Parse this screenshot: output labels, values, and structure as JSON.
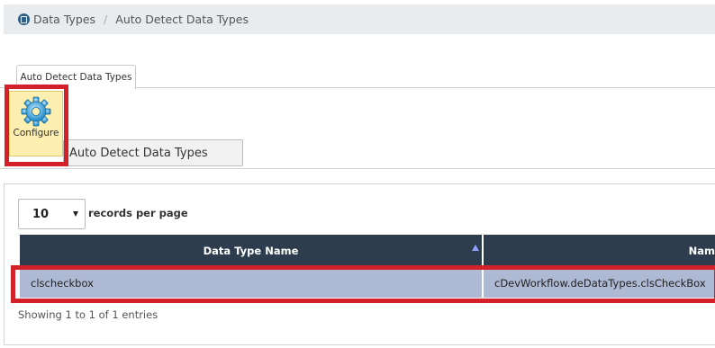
{
  "breadcrumb": {
    "icon": "data-types-icon",
    "root": "Data Types",
    "separator": "/",
    "current": "Auto Detect Data Types"
  },
  "tabs": [
    {
      "label": "Auto Detect Data Types",
      "active": true
    }
  ],
  "ribbon": {
    "configure_label": "Configure",
    "configure_icon": "gear-icon",
    "section_label": "Auto Detect Data Types"
  },
  "table_controls": {
    "page_size": "10",
    "records_per_page_label": "records per page"
  },
  "table": {
    "columns": [
      "Data Type Name",
      "Nam"
    ],
    "sorted_column": "Data Type Name",
    "rows": [
      [
        "clscheckbox",
        "cDevWorkflow.deDataTypes.clsCheckBox"
      ]
    ]
  },
  "footer": {
    "info": "Showing 1 to 1 of 1 entries"
  },
  "colors": {
    "highlight": "#d42028",
    "header_bg": "#2e3d4e",
    "selected_row": "#aeb9d3",
    "configure_bg": "#fcefb0"
  }
}
